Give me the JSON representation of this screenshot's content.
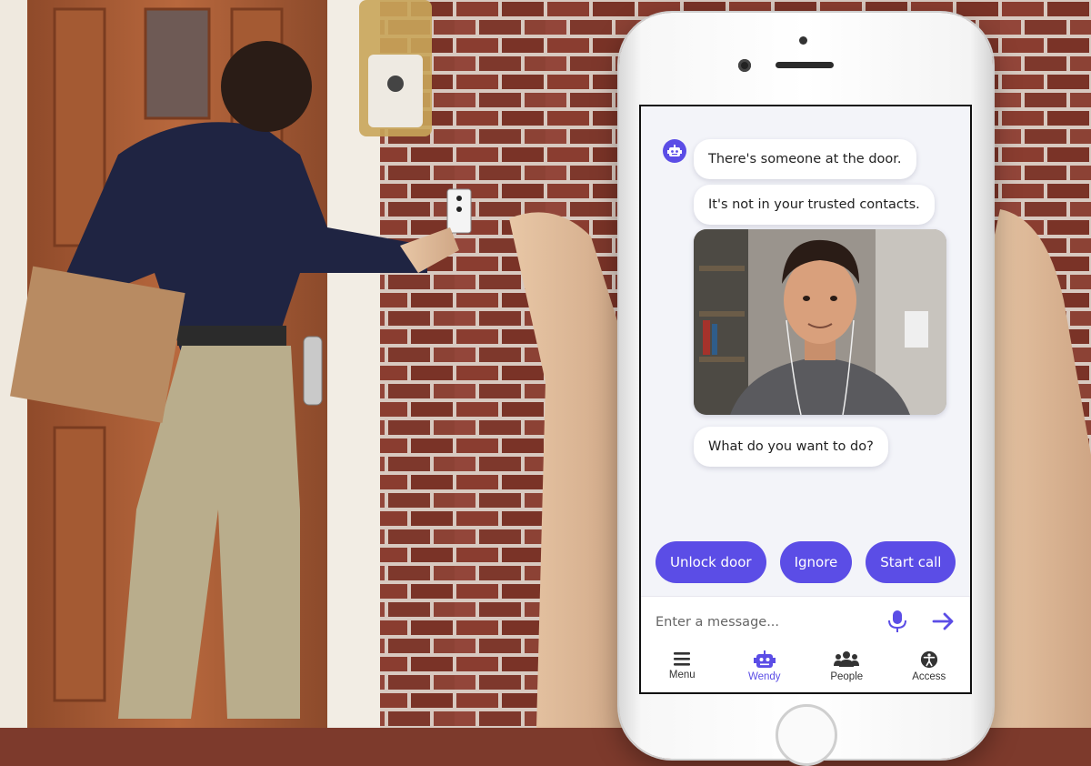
{
  "chat": {
    "messages": [
      "There's someone at the door.",
      "It's not in your trusted contacts.",
      "What do you want to do?"
    ]
  },
  "actions": {
    "unlock_label": "Unlock door",
    "ignore_label": "Ignore",
    "call_label": "Start call"
  },
  "composer": {
    "placeholder": "Enter a message..."
  },
  "tabs": [
    {
      "label": "Menu",
      "icon": "menu-icon"
    },
    {
      "label": "Wendy",
      "icon": "robot-icon",
      "active": true
    },
    {
      "label": "People",
      "icon": "people-icon"
    },
    {
      "label": "Access",
      "icon": "accessibility-icon"
    }
  ],
  "colors": {
    "accent": "#5b4de6",
    "screen_bg": "#f3f4f9",
    "bubble_bg": "#ffffff"
  }
}
